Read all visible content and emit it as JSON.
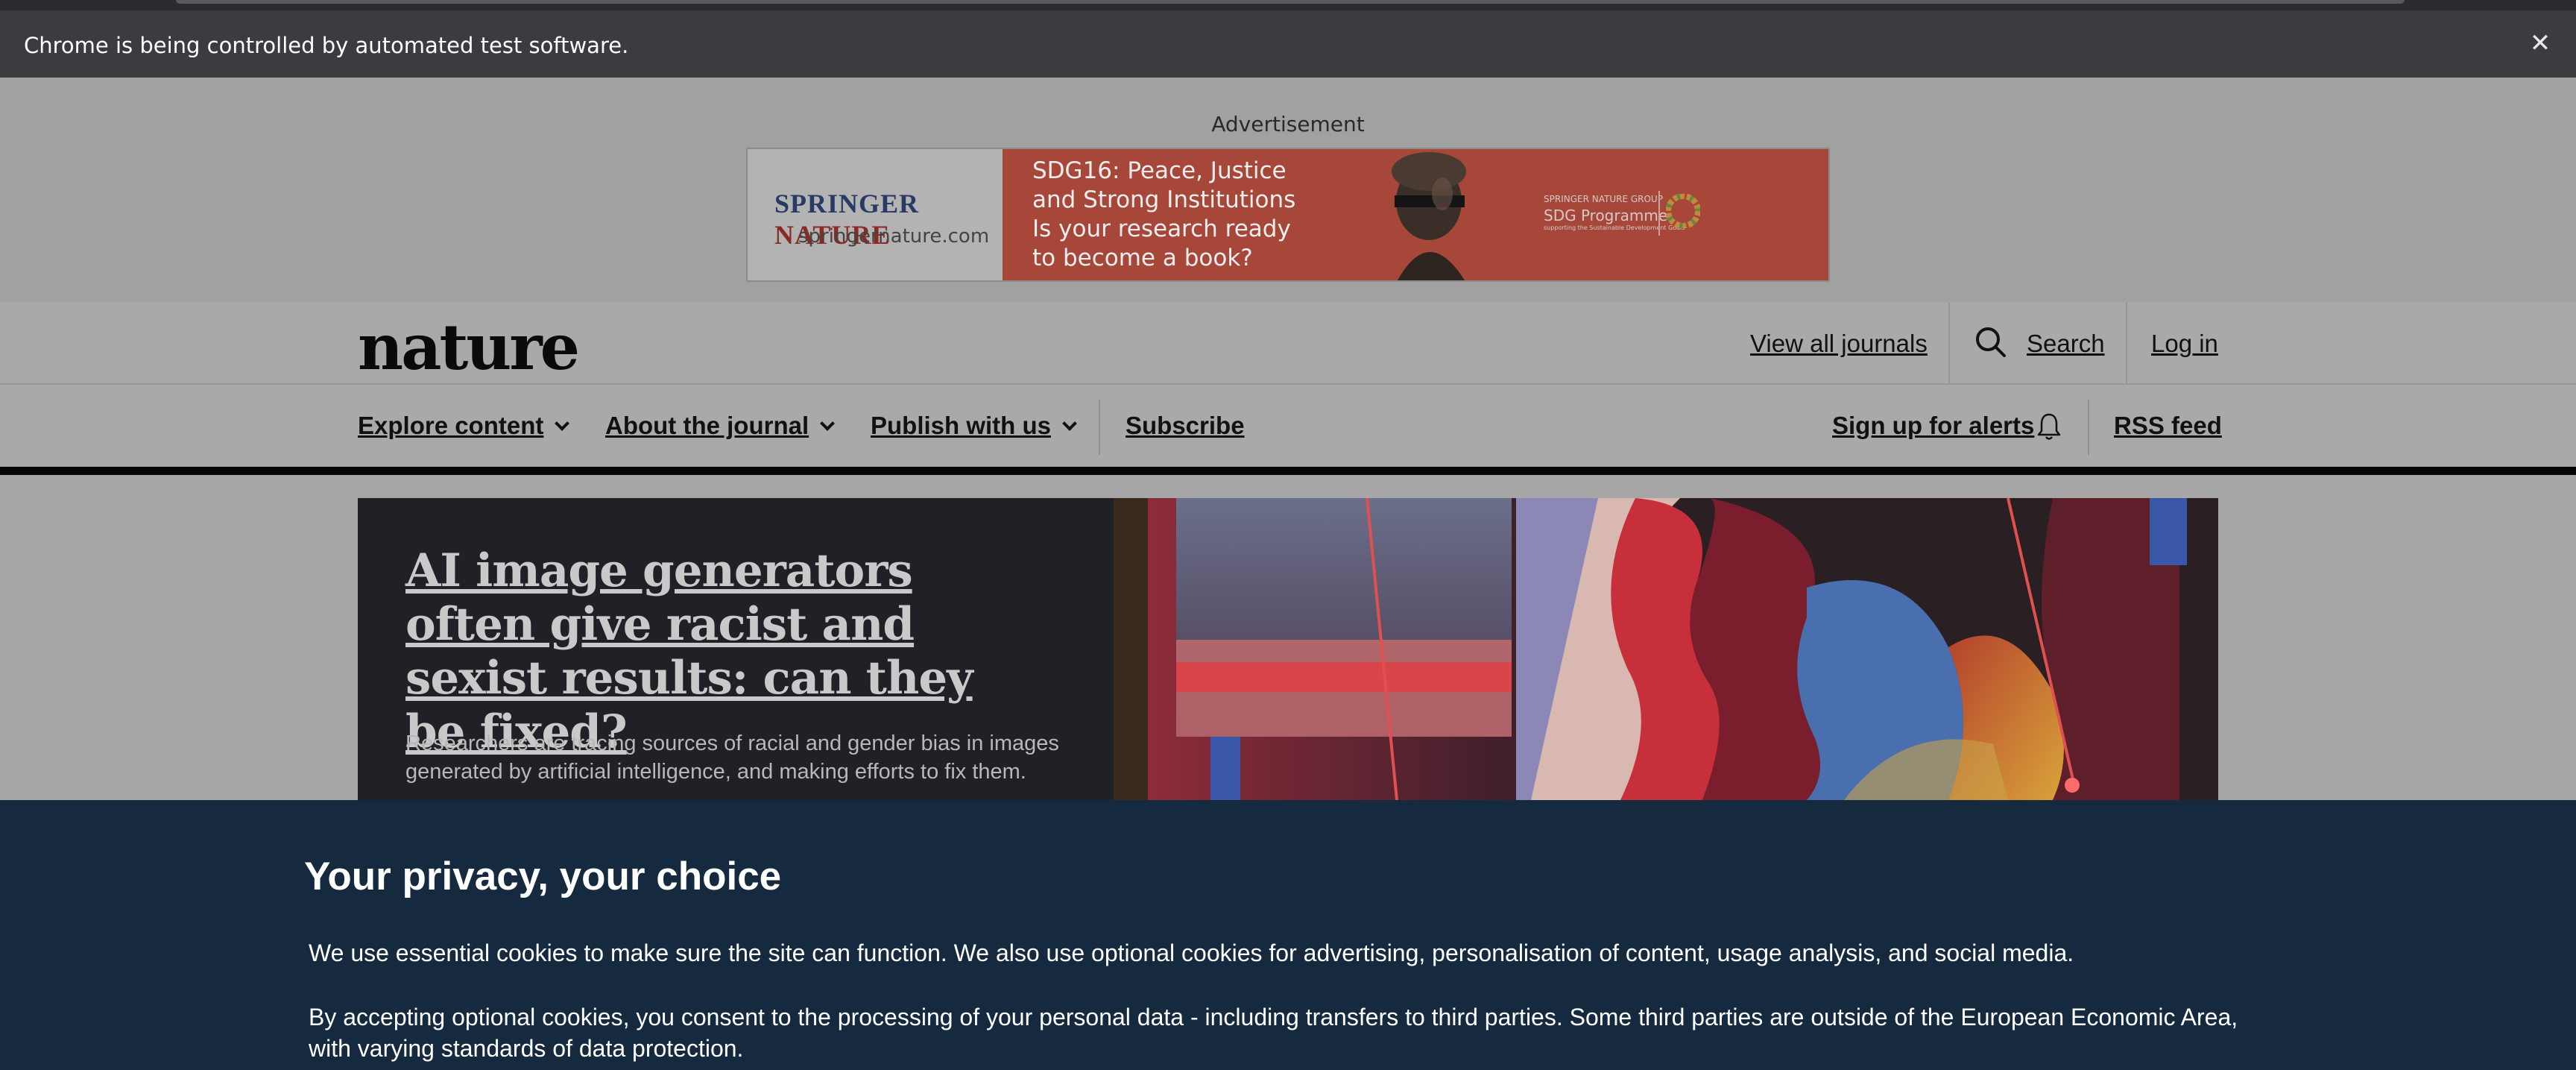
{
  "infobar": {
    "message": "Chrome is being controlled by automated test software.",
    "close_icon": "close-icon"
  },
  "advertisement": {
    "label": "Advertisement",
    "banner": {
      "brand_part1": "Springer",
      "brand_part2": "Nature",
      "url": "springernature.com",
      "line1": "SDG16: Peace, Justice",
      "line2": "and Strong Institutions",
      "line3": "Is your research ready",
      "line4": "to become a book?",
      "program_group": "SPRINGER NATURE GROUP",
      "program_name": "SDG Programme",
      "program_sub": "supporting the Sustainable Development Goals",
      "colors": {
        "left_panel": "#b3b3b3",
        "right_panel": "#a6473a",
        "brand_navy": "#2a3a66",
        "brand_red": "#8a2a22"
      }
    }
  },
  "header": {
    "logo": "nature",
    "view_all_journals": "View all journals",
    "search_label": "Search",
    "search_icon": "search-icon",
    "login": "Log in"
  },
  "nav": {
    "items": [
      {
        "label": "Explore content",
        "has_dropdown": true
      },
      {
        "label": "About the journal",
        "has_dropdown": true
      },
      {
        "label": "Publish with us",
        "has_dropdown": true
      },
      {
        "label": "Subscribe",
        "has_dropdown": false
      }
    ],
    "alerts": "Sign up for alerts",
    "alerts_icon": "bell-icon",
    "rss": "RSS feed"
  },
  "hero": {
    "title": "AI image generators often give racist and sexist results: can they be fixed?",
    "summary": "Researchers are tracing sources of racial and gender bias in images generated by artificial intelligence, and making efforts to fix them."
  },
  "cookie_banner": {
    "title": "Your privacy, your choice",
    "paragraph1": "We use essential cookies to make sure the site can function. We also use optional cookies for advertising, personalisation of content, usage analysis, and social media.",
    "paragraph2": "By accepting optional cookies, you consent to the processing of your personal data - including transfers to third parties. Some third parties are outside of the European Economic Area, with varying standards of data protection.",
    "background_color": "#15293f"
  }
}
